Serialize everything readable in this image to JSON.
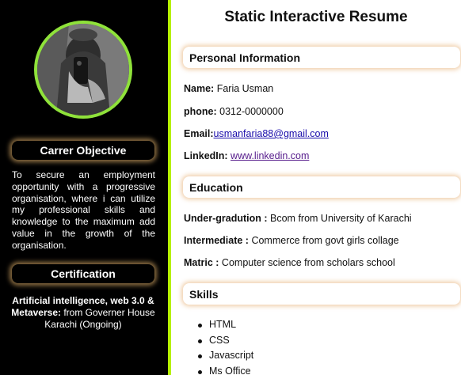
{
  "sidebar": {
    "avatar_alt": "profile photo",
    "objective_heading": "Carrer Objective",
    "objective_text": "To secure an employment opportunity with a progressive organisation, where i can utilize my professional skills and knowledge to the maximum add value in the growth of the organisation.",
    "certification_heading": "Certification",
    "certification": {
      "title": "Artificial intelligence, web 3.0 & Metaverse:",
      "detail": " from Governer House Karachi (Ongoing)"
    }
  },
  "main": {
    "title": "Static Interactive Resume",
    "personal": {
      "heading": "Personal Information",
      "name_label": "Name:",
      "name_value": " Faria Usman",
      "phone_label": "phone:",
      "phone_value": " 0312-0000000",
      "email_label": "Email:",
      "email_value": "usmanfaria88@gmail.com",
      "linkedin_label": "LinkedIn:",
      "linkedin_value": "www.linkedin.com"
    },
    "education": {
      "heading": "Education",
      "items": [
        {
          "label": "Under-gradution :",
          "value": " Bcom from University of Karachi"
        },
        {
          "label": "Intermediate :",
          "value": " Commerce from govt girls collage"
        },
        {
          "label": "Matric :",
          "value": " Computer science from scholars school"
        }
      ]
    },
    "skills": {
      "heading": "Skills",
      "items": [
        "HTML",
        "CSS",
        "Javascript",
        "Ms Office"
      ]
    }
  },
  "colors": {
    "sidebar_bg": "#000000",
    "accent_green": "#b5f000",
    "avatar_ring": "#8fe23a",
    "heading_glow": "#f0c48a",
    "link_blue": "#1a0dab",
    "link_visited": "#551a8b"
  }
}
